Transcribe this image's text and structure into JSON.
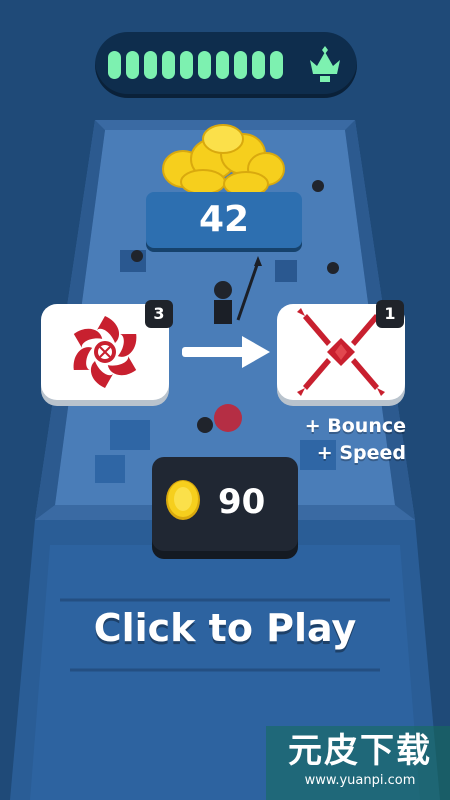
{
  "progress": {
    "level_fraction": 1.0,
    "segments": 10,
    "icon": "crown-icon"
  },
  "score": {
    "value": "42"
  },
  "upgrade": {
    "current_item": {
      "icon": "shuriken-icon",
      "level": "3"
    },
    "next_item": {
      "icon": "spiked-star-icon",
      "level": "1"
    },
    "bonus_lines": [
      "+ Bounce",
      "+ Speed"
    ]
  },
  "wallet": {
    "icon": "coin-icon",
    "amount": "90"
  },
  "cta": {
    "label": "Click to Play"
  },
  "watermark": {
    "title": "元皮下载",
    "url": "www.yuanpi.com"
  },
  "colors": {
    "background": "#1f4a78",
    "progress_fill": "#7df1b0",
    "accent_red": "#c8202f",
    "coin": "#f6cf1d"
  }
}
